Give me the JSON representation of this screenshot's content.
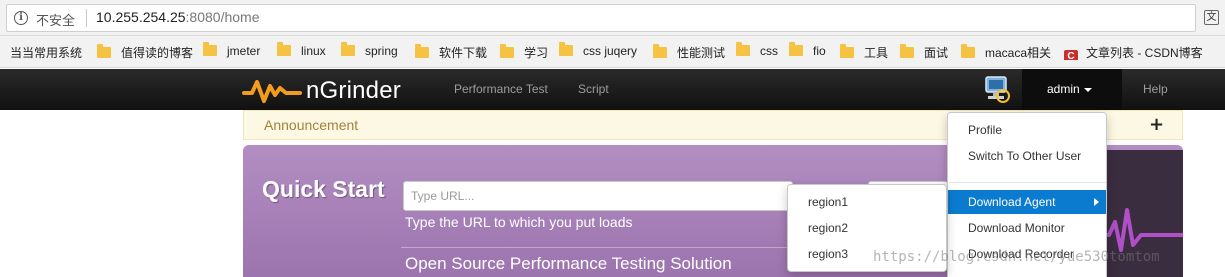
{
  "browser": {
    "insecure_label": "不安全",
    "url_host": "10.255.254.25",
    "url_rest": ":8080/home",
    "translate_icon": "translate-icon"
  },
  "bookmarks": [
    {
      "label": "当当常用系统",
      "icon": "none"
    },
    {
      "label": "值得读的博客",
      "icon": "folder-icon"
    },
    {
      "label": "jmeter",
      "icon": "folder-icon"
    },
    {
      "label": "linux",
      "icon": "folder-icon"
    },
    {
      "label": "spring",
      "icon": "folder-icon"
    },
    {
      "label": "软件下载",
      "icon": "folder-icon"
    },
    {
      "label": "学习",
      "icon": "folder-icon"
    },
    {
      "label": "css juqery",
      "icon": "folder-icon"
    },
    {
      "label": "性能测试",
      "icon": "folder-icon"
    },
    {
      "label": "css",
      "icon": "folder-icon"
    },
    {
      "label": "fio",
      "icon": "folder-icon"
    },
    {
      "label": "工具",
      "icon": "folder-icon"
    },
    {
      "label": "面试",
      "icon": "folder-icon"
    },
    {
      "label": "macaca相关",
      "icon": "folder-icon"
    },
    {
      "label": "文章列表 - CSDN博客",
      "icon": "csdn-icon"
    }
  ],
  "navbar": {
    "logo_text": "nGrinder",
    "performance_test": "Performance Test",
    "script": "Script",
    "user": "admin",
    "help": "Help"
  },
  "announcement": {
    "title": "Announcement"
  },
  "quick_start": {
    "title": "Quick Start",
    "url_placeholder": "Type URL...",
    "hint": "Type the URL to which you put loads",
    "solution": "Open Source Performance Testing Solution"
  },
  "user_menu": {
    "items": [
      "Profile",
      "Switch To Other User",
      "Download Agent",
      "Download Monitor",
      "Download Recorder"
    ],
    "active": "Download Agent"
  },
  "agent_submenu": {
    "items": [
      "region1",
      "region2",
      "region3"
    ]
  },
  "watermark": "https://blog.csdn.net/yue530tomtom",
  "colors": {
    "navbar": "#1b1b1b",
    "quick_start": "#a67fb8",
    "active_menu": "#0a7bce",
    "announcement_bg": "#fcf8e3",
    "logo_orange": "#f39c1f"
  }
}
